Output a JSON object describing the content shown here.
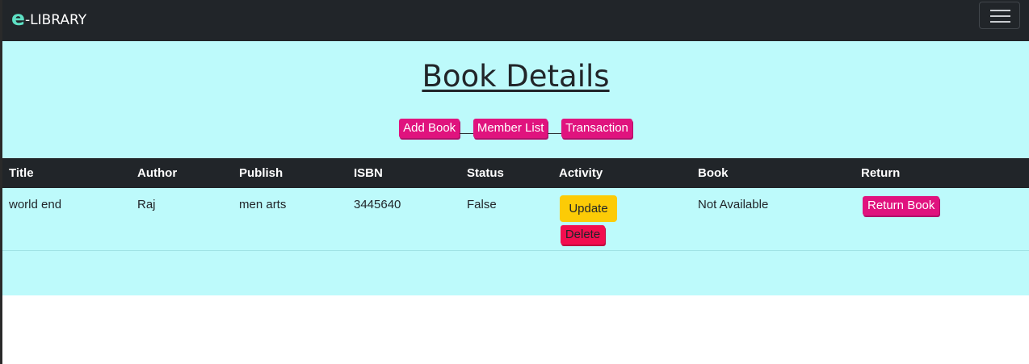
{
  "navbar": {
    "brand_letter": "e",
    "brand_rest": "-LIBRARY"
  },
  "header": {
    "title": "Book Details"
  },
  "actions": {
    "add_book": "Add Book",
    "separator": "__",
    "member_list": "Member List",
    "transaction": "Transaction"
  },
  "table": {
    "columns": [
      "Title",
      "Author",
      "Publish",
      "ISBN",
      "Status",
      "Activity",
      "Book",
      "Return"
    ],
    "rows": [
      {
        "title": "world end",
        "author": "Raj",
        "publish": "men arts",
        "isbn": "3445640",
        "status": "False",
        "update_label": "Update",
        "delete_label": "Delete",
        "book": "Not Available",
        "return_label": "Return Book"
      }
    ]
  },
  "colors": {
    "navbar_bg": "#212529",
    "hero_bg": "#bdfafb",
    "brand_accent": "#5ee0c4",
    "pink_button": "#e0137e",
    "update_button": "#fccb06",
    "delete_button": "#f20e4f"
  },
  "icons": {
    "menu": "hamburger-icon"
  }
}
